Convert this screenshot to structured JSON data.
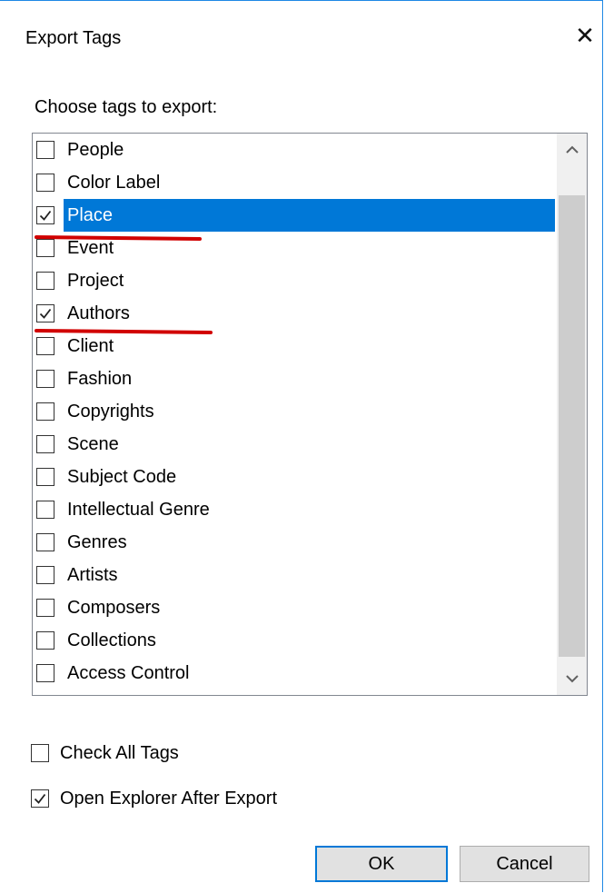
{
  "dialog": {
    "title": "Export Tags",
    "close_icon": "close-icon",
    "prompt": "Choose tags to export:"
  },
  "tags": [
    {
      "label": "People",
      "checked": false,
      "selected": false
    },
    {
      "label": "Color Label",
      "checked": false,
      "selected": false
    },
    {
      "label": "Place",
      "checked": true,
      "selected": true
    },
    {
      "label": "Event",
      "checked": false,
      "selected": false
    },
    {
      "label": "Project",
      "checked": false,
      "selected": false
    },
    {
      "label": "Authors",
      "checked": true,
      "selected": false
    },
    {
      "label": "Client",
      "checked": false,
      "selected": false
    },
    {
      "label": "Fashion",
      "checked": false,
      "selected": false
    },
    {
      "label": "Copyrights",
      "checked": false,
      "selected": false
    },
    {
      "label": "Scene",
      "checked": false,
      "selected": false
    },
    {
      "label": "Subject Code",
      "checked": false,
      "selected": false
    },
    {
      "label": "Intellectual Genre",
      "checked": false,
      "selected": false
    },
    {
      "label": "Genres",
      "checked": false,
      "selected": false
    },
    {
      "label": "Artists",
      "checked": false,
      "selected": false
    },
    {
      "label": "Composers",
      "checked": false,
      "selected": false
    },
    {
      "label": "Collections",
      "checked": false,
      "selected": false
    },
    {
      "label": "Access Control",
      "checked": false,
      "selected": false
    }
  ],
  "options": {
    "check_all": {
      "label": "Check All Tags",
      "checked": false
    },
    "open_explorer": {
      "label": "Open Explorer After Export",
      "checked": true
    }
  },
  "buttons": {
    "ok": "OK",
    "cancel": "Cancel"
  },
  "colors": {
    "selection": "#0078d7",
    "annotation": "#d10000",
    "window_border": "#1e88e5"
  }
}
